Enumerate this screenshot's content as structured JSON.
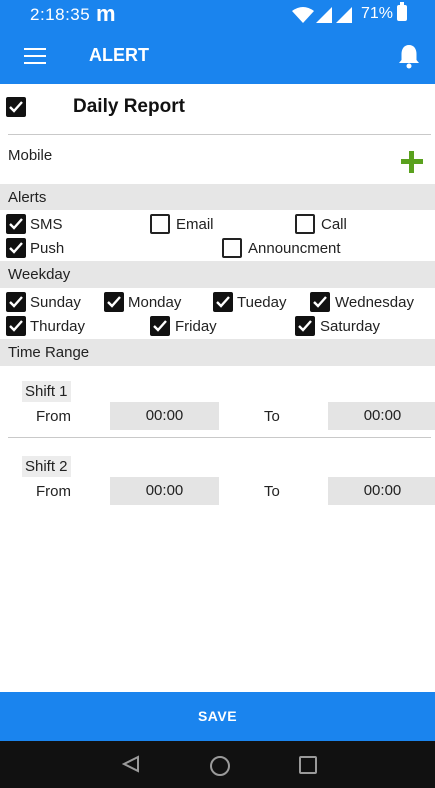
{
  "status_bar": {
    "time": "2:18:35",
    "app_logo": "m",
    "battery": "71%"
  },
  "app_bar": {
    "title": "ALERT",
    "menu_icon": "hamburger-menu-icon",
    "notification_icon": "bell-icon"
  },
  "daily_report": {
    "label": "Daily Report",
    "checked": true
  },
  "mobile": {
    "label": "Mobile",
    "add_icon": "plus-icon"
  },
  "alerts": {
    "header": "Alerts",
    "options": [
      {
        "label": "SMS",
        "checked": true
      },
      {
        "label": "Email",
        "checked": false
      },
      {
        "label": "Call",
        "checked": false
      },
      {
        "label": "Push",
        "checked": true
      },
      {
        "label": "Announcment",
        "checked": false
      }
    ]
  },
  "weekday": {
    "header": "Weekday",
    "days": [
      {
        "label": "Sunday",
        "checked": true
      },
      {
        "label": "Monday",
        "checked": true
      },
      {
        "label": "Tueday",
        "checked": true
      },
      {
        "label": "Wednesday",
        "checked": true
      },
      {
        "label": "Thurday",
        "checked": true
      },
      {
        "label": "Friday",
        "checked": true
      },
      {
        "label": "Saturday",
        "checked": true
      }
    ]
  },
  "time_range": {
    "header": "Time Range",
    "shifts": [
      {
        "label": "Shift 1",
        "from_label": "From",
        "from_value": "00:00",
        "to_label": "To",
        "to_value": "00:00"
      },
      {
        "label": "Shift 2",
        "from_label": "From",
        "from_value": "00:00",
        "to_label": "To",
        "to_value": "00:00"
      }
    ]
  },
  "save_label": "SAVE",
  "colors": {
    "primary": "#1a84ee",
    "add_green": "#5aa11e",
    "section_bg": "#e6e6e6",
    "nav_bar": "#111111"
  }
}
